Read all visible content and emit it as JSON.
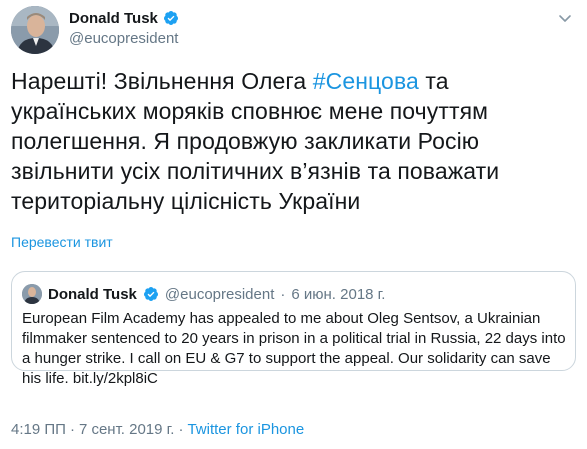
{
  "author": {
    "name": "Donald Tusk",
    "handle": "@eucopresident"
  },
  "tweet": {
    "text_before": "Нарешті! Звільнення Олега ",
    "hashtag": "#Сенцова",
    "text_after": " та українських моряків сповнює мене почуттям полегшення. Я продовжую закликати Росію звільнити усіх політичних в’язнів та поважати територіальну цілісність України"
  },
  "translate_label": "Перевести твит",
  "quoted": {
    "name": "Donald Tusk",
    "handle": "@eucopresident",
    "dot": "·",
    "date": "6 июн. 2018 г.",
    "text": "European Film Academy has appealed to me about Oleg Sentsov, a Ukrainian filmmaker sentenced to 20 years in prison in a political trial in Russia, 22 days into a hunger strike. I call on EU & G7 to support the appeal. Our solidarity can save his life. bit.ly/2kpl8iC"
  },
  "meta": {
    "time": "4:19 ПП",
    "date": "7 сент. 2019 г.",
    "dot": "·",
    "source": "Twitter for iPhone"
  },
  "colors": {
    "link": "#1b95e0",
    "secondary": "#657786",
    "border": "#ccd6dd"
  },
  "icons": {
    "verified": "verified-badge-icon",
    "menu": "chevron-down-icon"
  }
}
